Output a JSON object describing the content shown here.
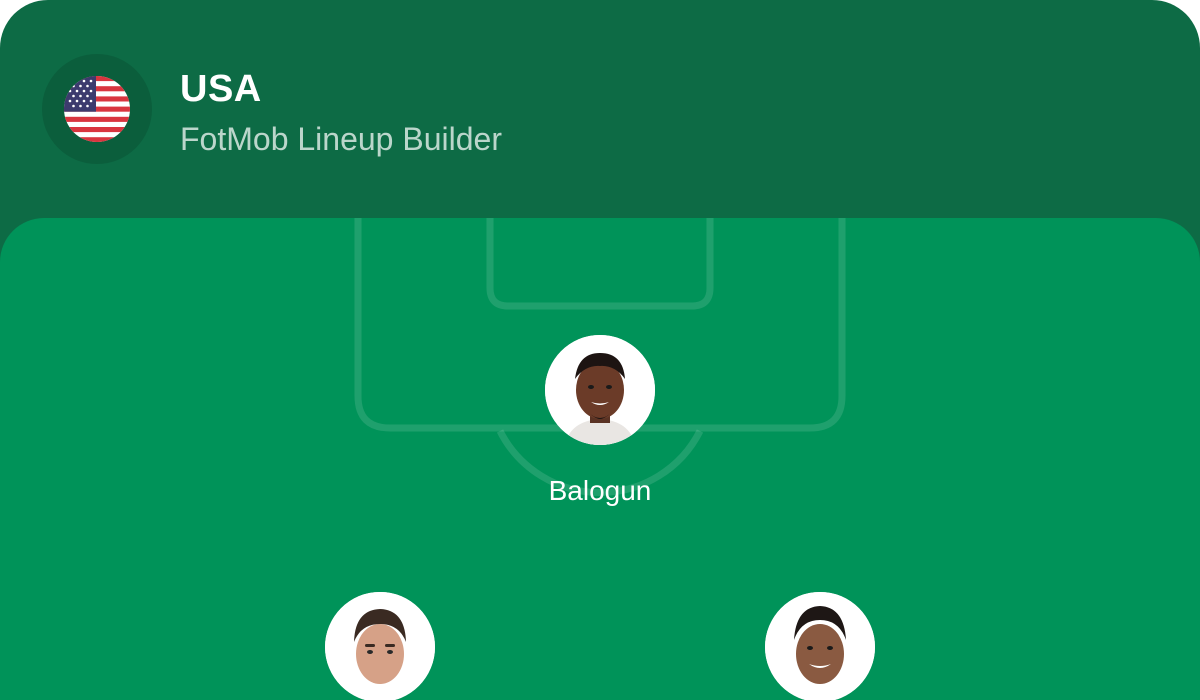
{
  "header": {
    "team_name": "USA",
    "subtitle": "FotMob Lineup Builder",
    "flag_icon": "usa-flag-icon"
  },
  "colors": {
    "header_bg": "#0d6b45",
    "pitch_bg": "#009359",
    "text": "#ffffff"
  },
  "players": [
    {
      "name": "Balogun",
      "avatar_icon": "player-photo-icon"
    },
    {
      "name": "",
      "avatar_icon": "player-photo-icon"
    },
    {
      "name": "",
      "avatar_icon": "player-photo-icon"
    }
  ]
}
